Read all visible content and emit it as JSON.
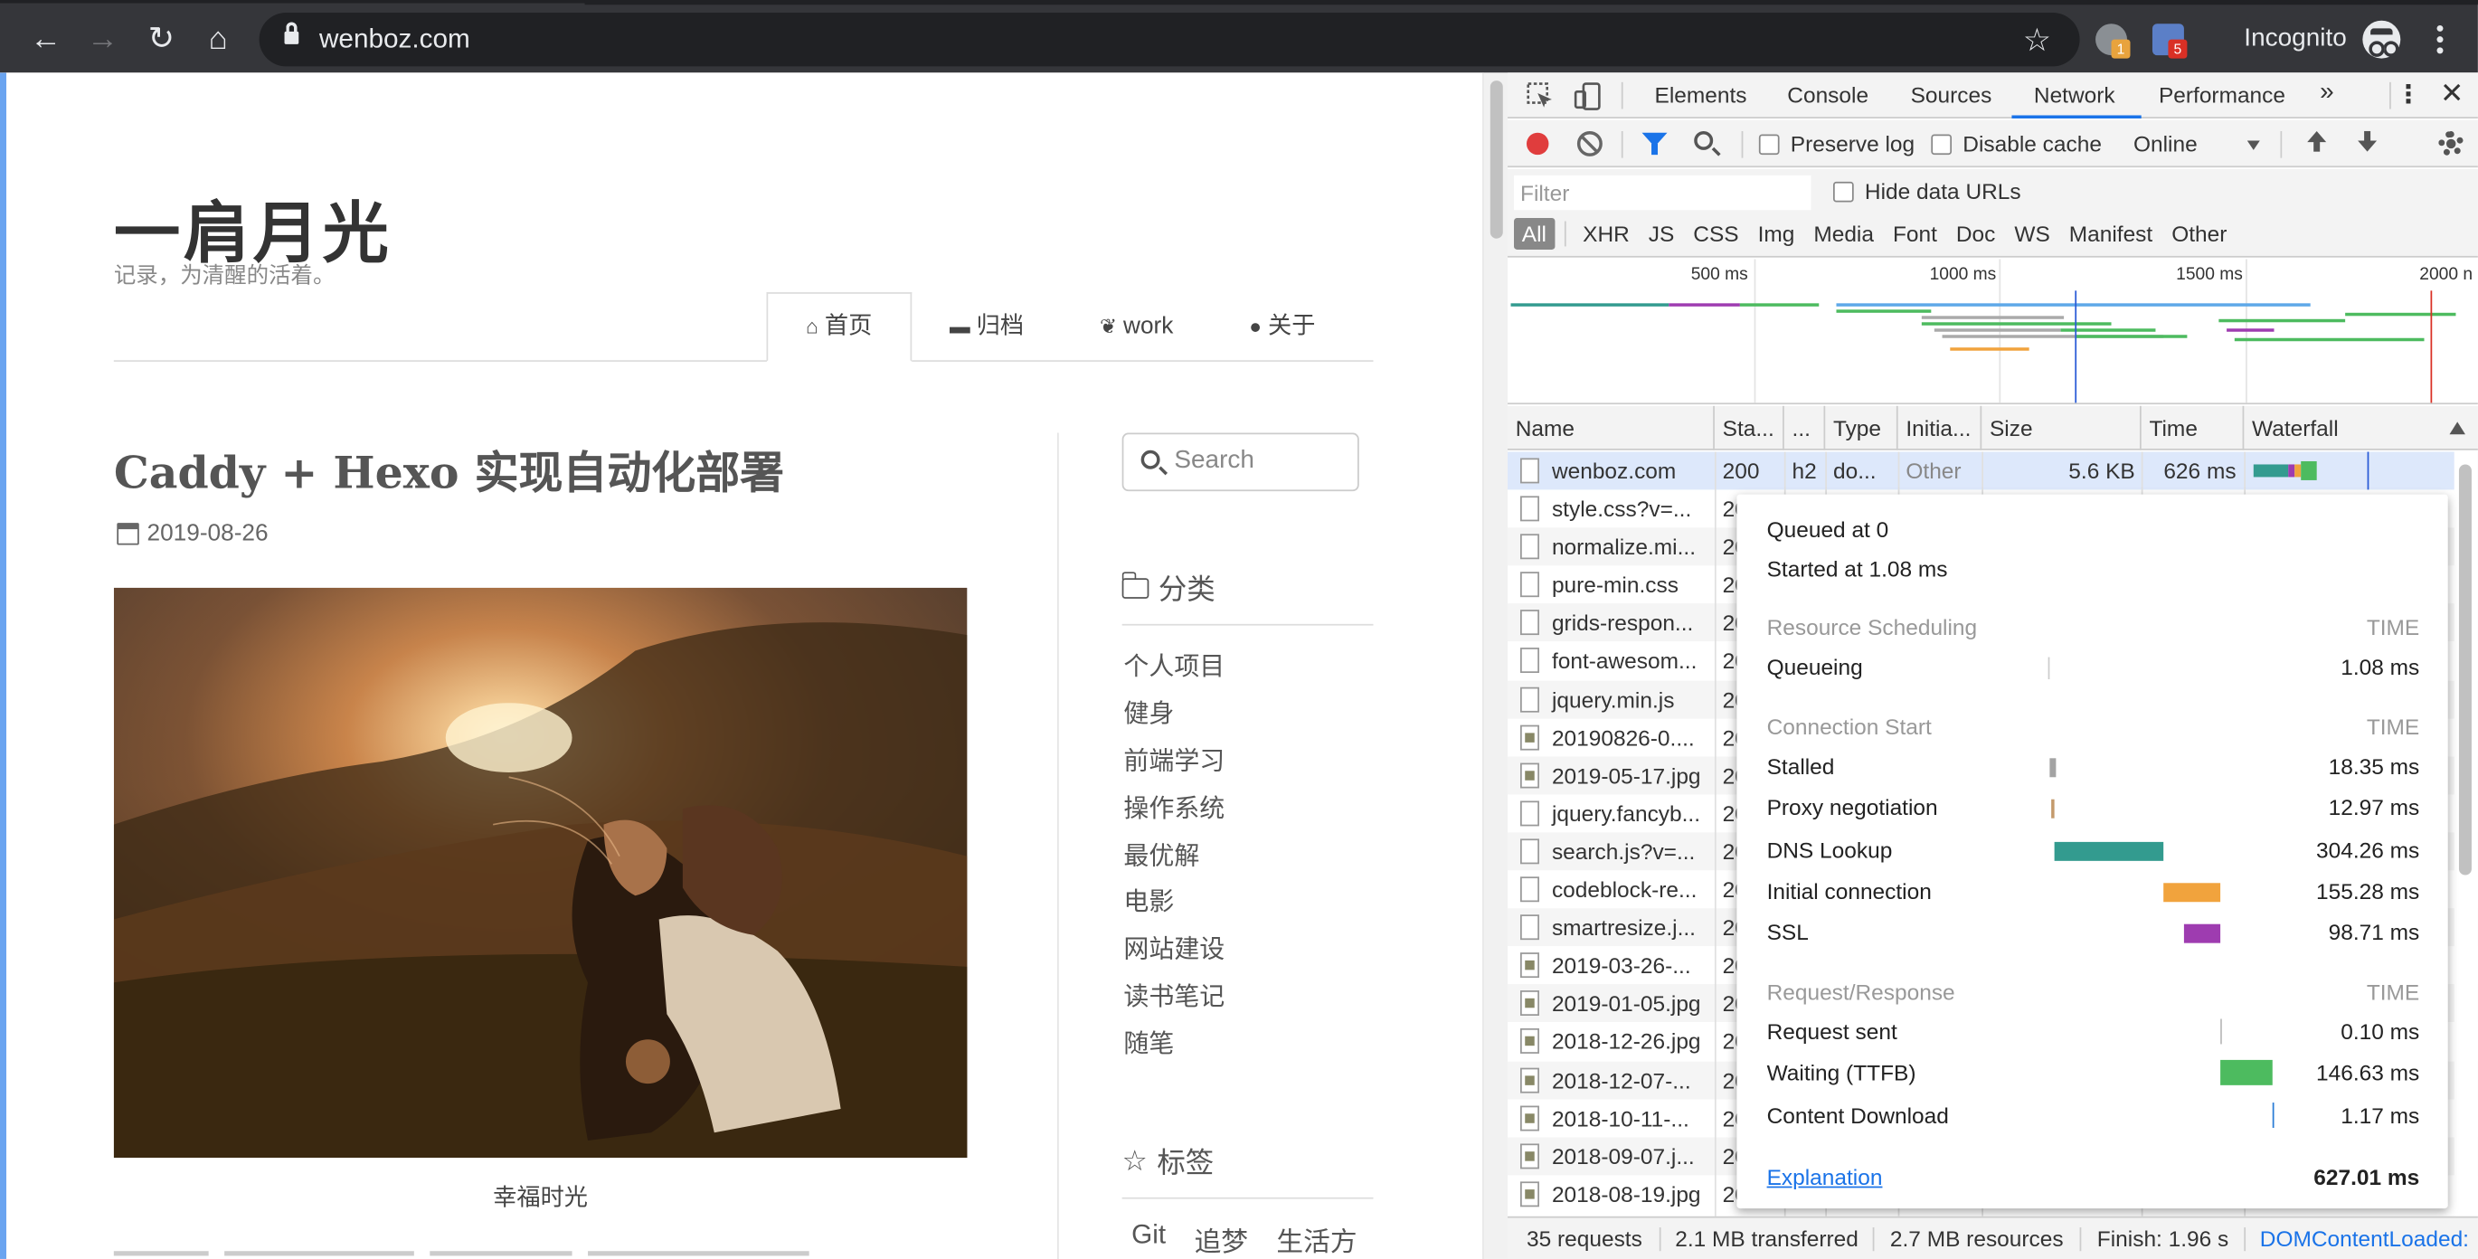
{
  "browser": {
    "url": "wenboz.com",
    "incognito_label": "Incognito",
    "ext_badges": [
      "1",
      "5"
    ],
    "colors": {
      "chrome_bg": "#35363a",
      "omnibox_bg": "#202124",
      "text": "#e8eaed"
    }
  },
  "site": {
    "title": "一肩月光",
    "description": "记录，为清醒的活着。",
    "menu": [
      {
        "label": "首页",
        "icon": "home-icon"
      },
      {
        "label": "归档",
        "icon": "archive-icon"
      },
      {
        "label": "work",
        "icon": "leaf-icon"
      },
      {
        "label": "关于",
        "icon": "user-icon"
      }
    ],
    "post": {
      "title": "Caddy + Hexo 实现自动化部署",
      "date": "2019-08-26",
      "photo_caption": "幸福时光"
    },
    "sidebar": {
      "search_placeholder": "Search",
      "categories_heading": "分类",
      "categories": [
        "个人项目",
        "健身",
        "前端学习",
        "操作系统",
        "最优解",
        "电影",
        "网站建设",
        "读书笔记",
        "随笔"
      ],
      "tags_heading": "标签",
      "tags": [
        "Git",
        "追梦",
        "生活方"
      ]
    }
  },
  "devtools": {
    "tabs": [
      "Elements",
      "Console",
      "Sources",
      "Network",
      "Performance"
    ],
    "more_tabs": "»",
    "active_tab": "Network",
    "toolbar": {
      "preserve_log": "Preserve log",
      "disable_cache": "Disable cache",
      "throttling": "Online"
    },
    "filter": {
      "placeholder": "Filter",
      "hide_data_urls": "Hide data URLs",
      "types": [
        "All",
        "XHR",
        "JS",
        "CSS",
        "Img",
        "Media",
        "Font",
        "Doc",
        "WS",
        "Manifest",
        "Other"
      ]
    },
    "overview_ticks": [
      "500 ms",
      "1000 ms",
      "1500 ms",
      "2000 n"
    ],
    "columns": [
      "Name",
      "Sta...",
      "...",
      "Type",
      "Initia...",
      "Size",
      "Time",
      "Waterfall"
    ],
    "rows": [
      {
        "name": "wenboz.com",
        "status": "200",
        "protocol": "h2",
        "type": "do...",
        "initiator": "Other",
        "size": "5.6 KB",
        "time": "626 ms",
        "icon": "doc-icon"
      },
      {
        "name": "style.css?v=...",
        "status": "20",
        "icon": "doc-icon"
      },
      {
        "name": "normalize.mi...",
        "status": "20",
        "icon": "doc-icon"
      },
      {
        "name": "pure-min.css",
        "status": "20",
        "icon": "doc-icon"
      },
      {
        "name": "grids-respon...",
        "status": "20",
        "icon": "doc-icon"
      },
      {
        "name": "font-awesom...",
        "status": "20",
        "icon": "doc-icon"
      },
      {
        "name": "jquery.min.js",
        "status": "20",
        "icon": "doc-icon"
      },
      {
        "name": "20190826-0....",
        "status": "20",
        "icon": "image-icon"
      },
      {
        "name": "2019-05-17.jpg",
        "status": "20",
        "icon": "image-icon"
      },
      {
        "name": "jquery.fancyb...",
        "status": "20",
        "icon": "doc-icon"
      },
      {
        "name": "search.js?v=...",
        "status": "20",
        "icon": "doc-icon"
      },
      {
        "name": "codeblock-re...",
        "status": "20",
        "icon": "doc-icon"
      },
      {
        "name": "smartresize.j...",
        "status": "20",
        "icon": "doc-icon"
      },
      {
        "name": "2019-03-26-...",
        "status": "20",
        "icon": "image-icon"
      },
      {
        "name": "2019-01-05.jpg",
        "status": "20",
        "icon": "image-icon"
      },
      {
        "name": "2018-12-26.jpg",
        "status": "20",
        "icon": "image-icon"
      },
      {
        "name": "2018-12-07-...",
        "status": "20",
        "icon": "image-icon"
      },
      {
        "name": "2018-10-11-...",
        "status": "20",
        "icon": "image-icon"
      },
      {
        "name": "2018-09-07.j...",
        "status": "20",
        "icon": "image-icon"
      },
      {
        "name": "2018-08-19.jpg",
        "status": "20",
        "icon": "image-icon"
      }
    ],
    "timing_tooltip": {
      "queued_at": "Queued at 0",
      "started_at": "Started at 1.08 ms",
      "time_header": "TIME",
      "sections": [
        {
          "title": "Resource Scheduling",
          "items": [
            {
              "label": "Queueing",
              "value": "1.08 ms",
              "color": "#bbbbbb"
            }
          ]
        },
        {
          "title": "Connection Start",
          "items": [
            {
              "label": "Stalled",
              "value": "18.35 ms",
              "color": "#a3a3a3"
            },
            {
              "label": "Proxy negotiation",
              "value": "12.97 ms",
              "color": "#c49a6c"
            },
            {
              "label": "DNS Lookup",
              "value": "304.26 ms",
              "color": "#339b8f"
            },
            {
              "label": "Initial connection",
              "value": "155.28 ms",
              "color": "#f1a33d"
            },
            {
              "label": "SSL",
              "value": "98.71 ms",
              "color": "#9e3cb0"
            }
          ]
        },
        {
          "title": "Request/Response",
          "items": [
            {
              "label": "Request sent",
              "value": "0.10 ms",
              "color": "#bbbbbb"
            },
            {
              "label": "Waiting (TTFB)",
              "value": "146.63 ms",
              "color": "#4dbb5f"
            },
            {
              "label": "Content Download",
              "value": "1.17 ms",
              "color": "#2a7bd6"
            }
          ]
        }
      ],
      "explanation": "Explanation",
      "total": "627.01 ms"
    },
    "status": {
      "requests": "35 requests",
      "transferred": "2.1 MB transferred",
      "resources": "2.7 MB resources",
      "finish": "Finish: 1.96 s",
      "dom_content_loaded": "DOMContentLoaded:"
    }
  }
}
